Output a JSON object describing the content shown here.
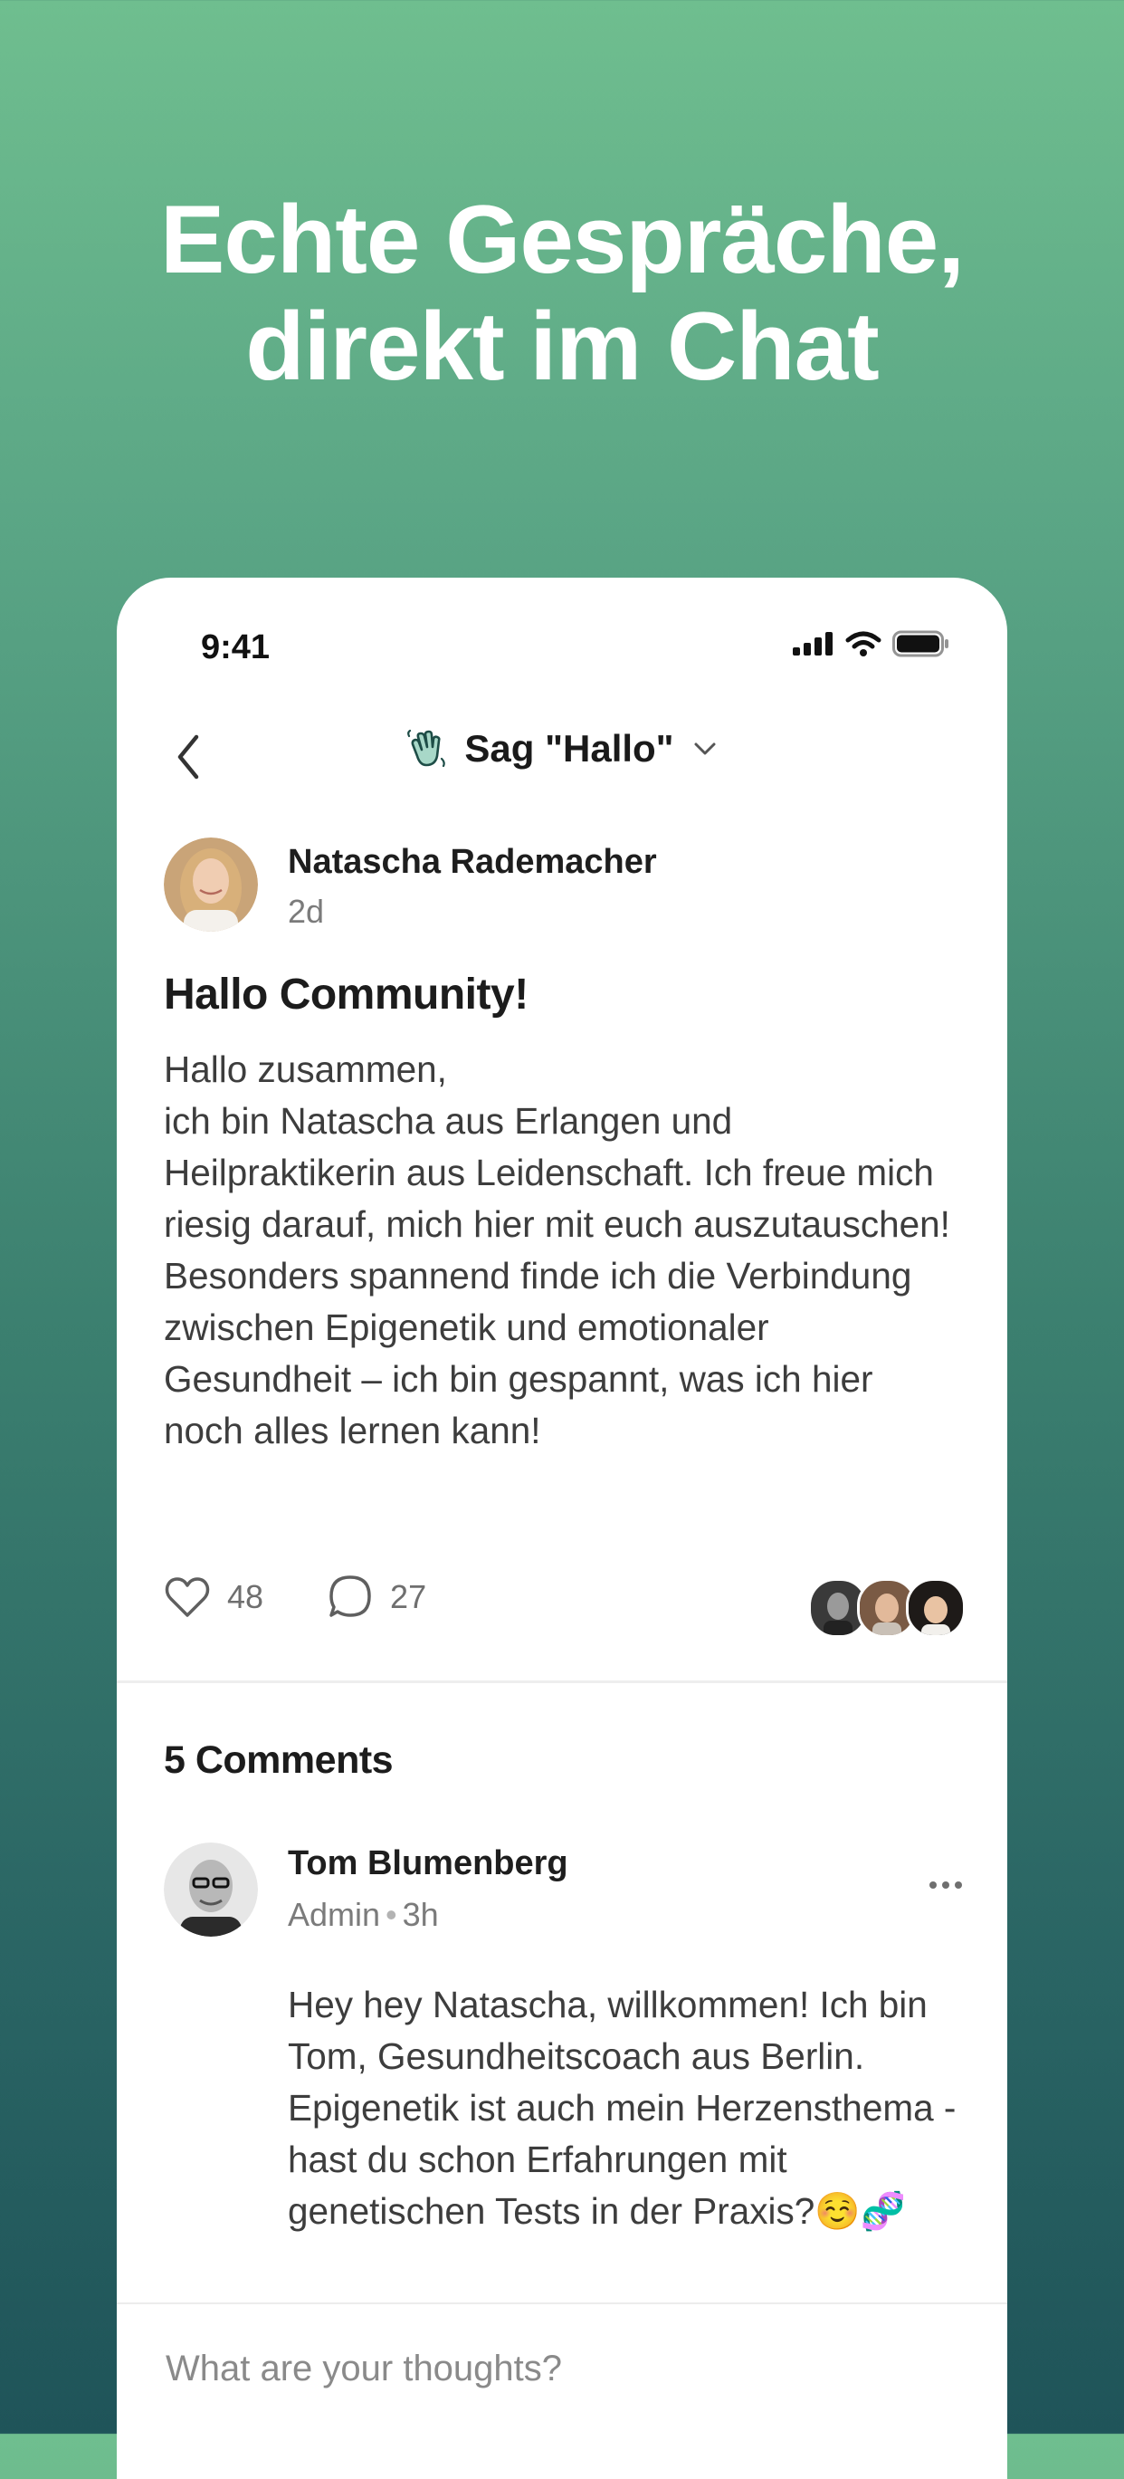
{
  "headline": {
    "line1": "Echte Gespräche,",
    "line2": "direkt im Chat"
  },
  "status_bar": {
    "time": "9:41"
  },
  "nav": {
    "title": "Sag \"Hallo\"",
    "space_icon": "waving-hand-icon"
  },
  "post": {
    "author": "Natascha Rademacher",
    "time": "2d",
    "title": "Hallo Community!",
    "body": "Hallo zusammen,\nich bin Natascha aus Erlangen und Heilpraktikerin aus Leidenschaft. Ich freue mich riesig darauf, mich hier mit euch auszutauschen! Besonders spannend finde ich die Verbindung zwischen Epigenetik und emotionaler Gesundheit – ich bin gespannt, was ich hier noch alles lernen kann!",
    "likes": "48",
    "comments": "27"
  },
  "comments": {
    "heading": "5 Comments",
    "items": [
      {
        "author": "Tom Blumenberg",
        "role": "Admin",
        "time": "3h",
        "body": "Hey hey Natascha, willkommen! Ich bin Tom, Gesundheitscoach aus Berlin. Epigenetik ist auch mein Herzensthema - hast du schon Erfahrungen mit genetischen Tests in der Praxis?☺️🧬"
      }
    ]
  },
  "composer": {
    "placeholder": "What are your thoughts?"
  },
  "colors": {
    "brand_green": "#6fbe8f",
    "deep_teal": "#1f5459"
  }
}
